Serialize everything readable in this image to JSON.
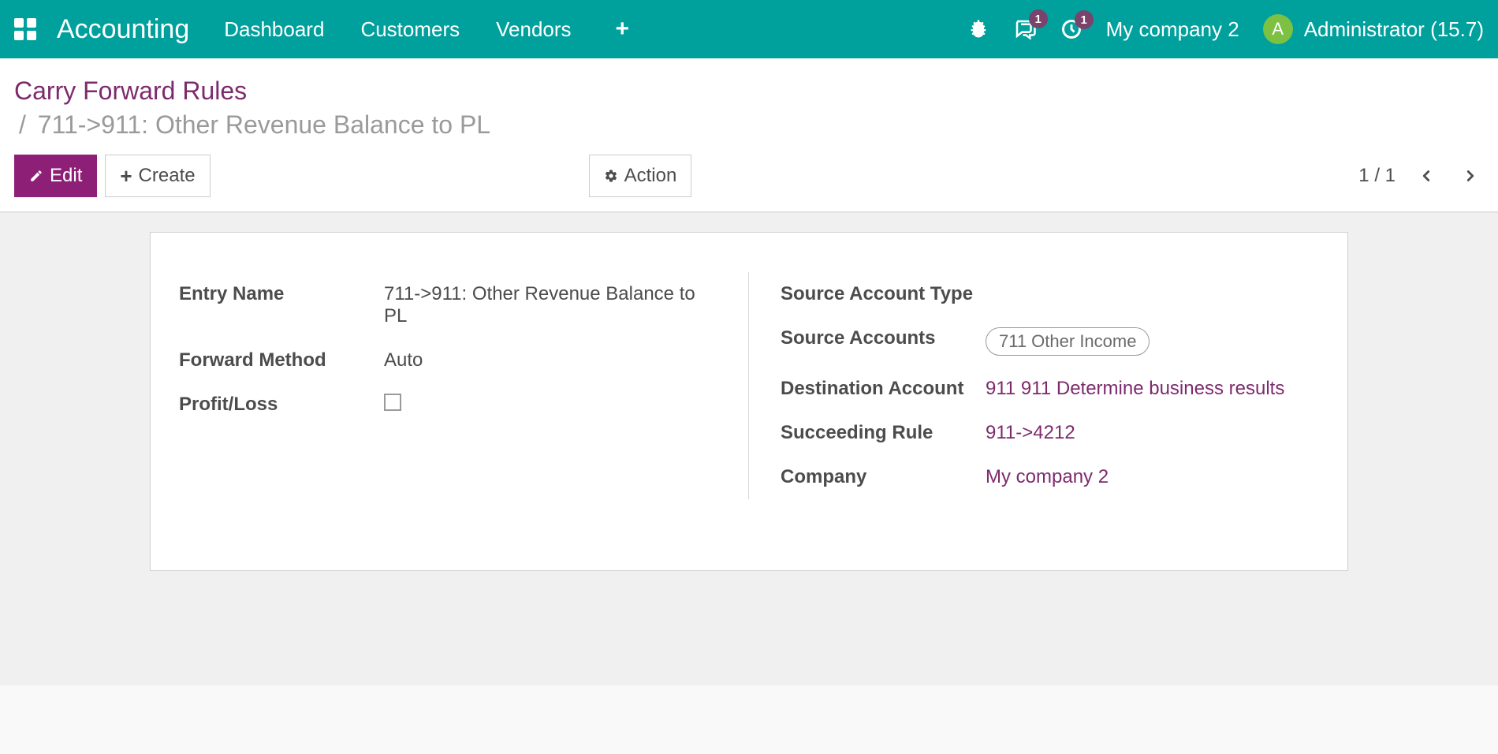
{
  "nav": {
    "brand": "Accounting",
    "items": [
      "Dashboard",
      "Customers",
      "Vendors"
    ],
    "messages_badge": "1",
    "activities_badge": "1",
    "company": "My company 2",
    "avatar_letter": "A",
    "username": "Administrator (15.7)"
  },
  "breadcrumb": {
    "root": "Carry Forward Rules",
    "sep": "/",
    "leaf": "711->911: Other Revenue Balance to PL"
  },
  "buttons": {
    "edit": "Edit",
    "create": "Create",
    "action": "Action"
  },
  "pager": {
    "text": "1 / 1"
  },
  "labels": {
    "entry_name": "Entry Name",
    "forward_method": "Forward Method",
    "profit_loss": "Profit/Loss",
    "source_account_type": "Source Account Type",
    "source_accounts": "Source Accounts",
    "destination_account": "Destination Account",
    "succeeding_rule": "Succeeding Rule",
    "company": "Company"
  },
  "values": {
    "entry_name": "711->911: Other Revenue Balance to PL",
    "forward_method": "Auto",
    "profit_loss_checked": false,
    "source_account_type": "",
    "source_accounts_tag": "711 Other Income",
    "destination_account": "911 911 Determine business results",
    "succeeding_rule": "911->4212",
    "company": "My company 2"
  }
}
